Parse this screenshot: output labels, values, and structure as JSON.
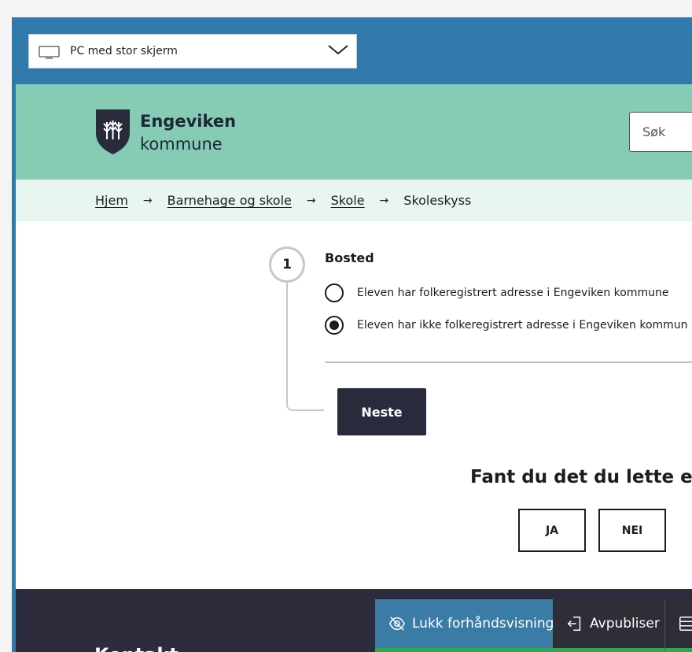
{
  "device_selector": {
    "label": "PC med stor skjerm"
  },
  "header": {
    "logo_name": "Engeviken",
    "logo_sub": "kommune",
    "search_placeholder": "Søk"
  },
  "breadcrumb": {
    "items": [
      "Hjem",
      "Barnehage og skole",
      "Skole"
    ],
    "current": "Skoleskyss",
    "separator": "→"
  },
  "form": {
    "step_number": "1",
    "fieldset_title": "Bosted",
    "options": [
      {
        "label": "Eleven har folkeregistrert adresse i Engeviken kommune",
        "checked": false
      },
      {
        "label": "Eleven har ikke folkeregistrert adresse i Engeviken kommun",
        "checked": true
      }
    ],
    "next_label": "Neste"
  },
  "feedback": {
    "question": "Fant du det du lette ett",
    "yes_label": "JA",
    "no_label": "NEI"
  },
  "footer": {
    "heading": "Kontakt"
  },
  "toolbar": {
    "close_preview_label": "Lukk forhåndsvisning",
    "unpublish_label": "Avpubliser"
  },
  "colors": {
    "frame": "#2f7aab",
    "header": "#86ccb4",
    "breadcrumb_bg": "#e8f5f1",
    "primary_button": "#2a2a3d",
    "footer": "#2c2c3c",
    "toolbar_accent": "#2fa84f"
  }
}
